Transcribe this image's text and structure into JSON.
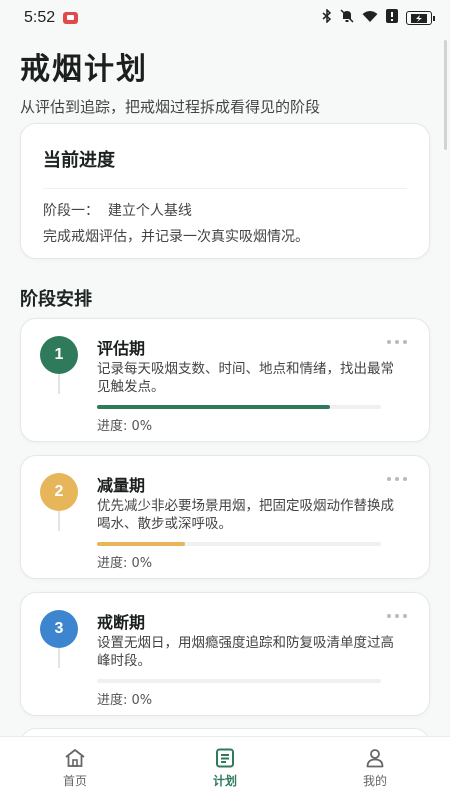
{
  "status_bar": {
    "time": "5:52",
    "icons": [
      "app-notification-icon",
      "bluetooth-icon",
      "mute-bell-icon",
      "wifi-icon",
      "alert-icon",
      "battery-charging-icon"
    ]
  },
  "header": {
    "title": "戒烟计划",
    "subtitle": "从评估到追踪，把戒烟过程拆成看得见的阶段"
  },
  "current_progress": {
    "title": "当前进度",
    "stage": "阶段一：  建立个人基线",
    "description": "完成戒烟评估，并记录一次真实吸烟情况。"
  },
  "stages_section": {
    "title": "阶段安排",
    "stages": [
      {
        "number": "1",
        "name": "评估期",
        "description": "记录每天吸烟支数、时间、地点和情绪，找出最常见触发点。",
        "progress_text": "进度: 0%",
        "bar_fill": 0.82,
        "color": "#2f7a5b"
      },
      {
        "number": "2",
        "name": "减量期",
        "description": "优先减少非必要场景用烟，把固定吸烟动作替换成喝水、散步或深呼吸。",
        "progress_text": "进度: 0%",
        "bar_fill": 0.31,
        "color": "#e7b65a"
      },
      {
        "number": "3",
        "name": "戒断期",
        "description": "设置无烟日，用烟瘾强度追踪和防复吸清单度过高峰时段。",
        "progress_text": "进度: 0%",
        "bar_fill": 0,
        "color": "#3d86cf"
      }
    ]
  },
  "tabbar": {
    "tabs": [
      {
        "label": "首页",
        "icon": "home-icon",
        "active": false
      },
      {
        "label": "计划",
        "icon": "plan-list-icon",
        "active": true
      },
      {
        "label": "我的",
        "icon": "profile-icon",
        "active": false
      }
    ]
  },
  "colors": {
    "accent": "#2f7a5b",
    "stage1": "#2f7a5b",
    "stage2": "#e7b65a",
    "stage3": "#3d86cf"
  }
}
